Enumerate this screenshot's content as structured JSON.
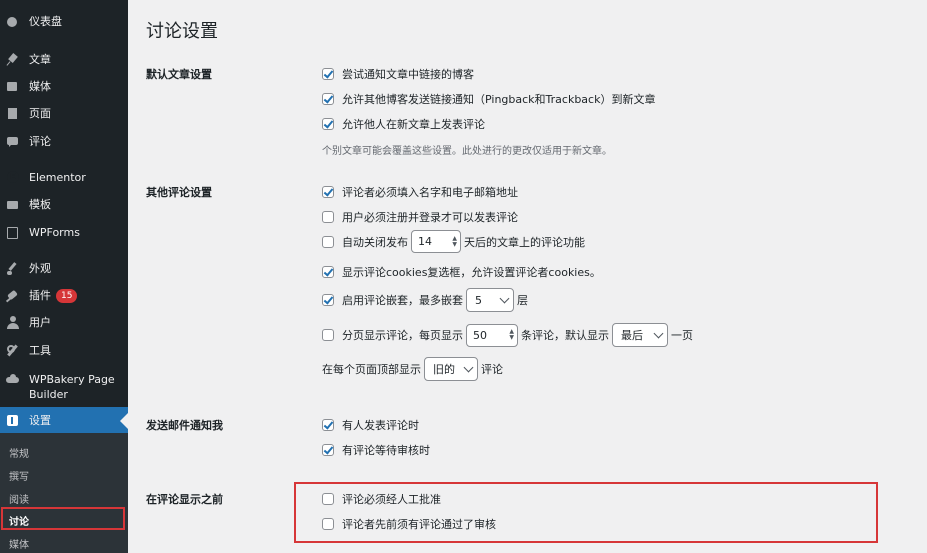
{
  "sidebar": {
    "items": [
      {
        "key": "dashboard",
        "label": "仪表盘",
        "icon": "dashboard-icon"
      },
      {
        "key": "posts",
        "label": "文章",
        "icon": "pin-icon"
      },
      {
        "key": "media",
        "label": "媒体",
        "icon": "media-icon"
      },
      {
        "key": "pages",
        "label": "页面",
        "icon": "page-icon"
      },
      {
        "key": "comments",
        "label": "评论",
        "icon": "comment-icon"
      },
      {
        "key": "elementor",
        "label": "Elementor",
        "icon": "elementor-icon"
      },
      {
        "key": "templates",
        "label": "模板",
        "icon": "folder-icon"
      },
      {
        "key": "wpforms",
        "label": "WPForms",
        "icon": "forms-icon"
      },
      {
        "key": "appearance",
        "label": "外观",
        "icon": "brush-icon"
      },
      {
        "key": "plugins",
        "label": "插件",
        "icon": "plugin-icon",
        "badge": "15"
      },
      {
        "key": "users",
        "label": "用户",
        "icon": "user-icon"
      },
      {
        "key": "tools",
        "label": "工具",
        "icon": "wrench-icon"
      },
      {
        "key": "wpbakery",
        "label": "WPBakery Page Builder",
        "icon": "cloud-icon"
      },
      {
        "key": "settings",
        "label": "设置",
        "icon": "settings-icon"
      }
    ],
    "submenu": [
      "常规",
      "撰写",
      "阅读",
      "讨论",
      "媒体"
    ],
    "submenu_current": "讨论"
  },
  "page": {
    "title": "讨论设置",
    "sections": {
      "default_article": {
        "label": "默认文章设置",
        "options": [
          {
            "text": "尝试通知文章中链接的博客",
            "checked": true
          },
          {
            "text": "允许其他博客发送链接通知（Pingback和Trackback）到新文章",
            "checked": true
          },
          {
            "text": "允许他人在新文章上发表评论",
            "checked": true
          }
        ],
        "note": "个别文章可能会覆盖这些设置。此处进行的更改仅适用于新文章。"
      },
      "other_comment": {
        "label": "其他评论设置",
        "require_name_email": {
          "text": "评论者必须填入名字和电子邮箱地址",
          "checked": true
        },
        "require_registration": {
          "text": "用户必须注册并登录才可以发表评论",
          "checked": false
        },
        "auto_close": {
          "prefix": "自动关闭发布",
          "value": "14",
          "suffix": "天后的文章上的评论功能",
          "checked": false
        },
        "cookies_optin": {
          "text": "显示评论cookies复选框，允许设置评论者cookies。",
          "checked": true
        },
        "threaded": {
          "prefix": "启用评论嵌套，最多嵌套",
          "value": "5",
          "suffix": "层",
          "checked": true
        },
        "paged": {
          "prefix": "分页显示评论，每页显示",
          "value": "50",
          "middle": "条评论，默认显示",
          "select": "最后",
          "suffix": "一页",
          "checked": false
        },
        "order": {
          "prefix": "在每个页面顶部显示",
          "select": "旧的",
          "suffix": "评论"
        }
      },
      "email_me": {
        "label": "发送邮件通知我",
        "options": [
          {
            "text": "有人发表评论时",
            "checked": true
          },
          {
            "text": "有评论等待审核时",
            "checked": true
          }
        ]
      },
      "before_appears": {
        "label": "在评论显示之前",
        "options": [
          {
            "text": "评论必须经人工批准",
            "checked": false
          },
          {
            "text": "评论者先前须有评论通过了审核",
            "checked": false
          }
        ]
      }
    }
  },
  "colors": {
    "accent": "#2271b1",
    "sidebar": "#1d2327",
    "highlight": "#d63638"
  }
}
